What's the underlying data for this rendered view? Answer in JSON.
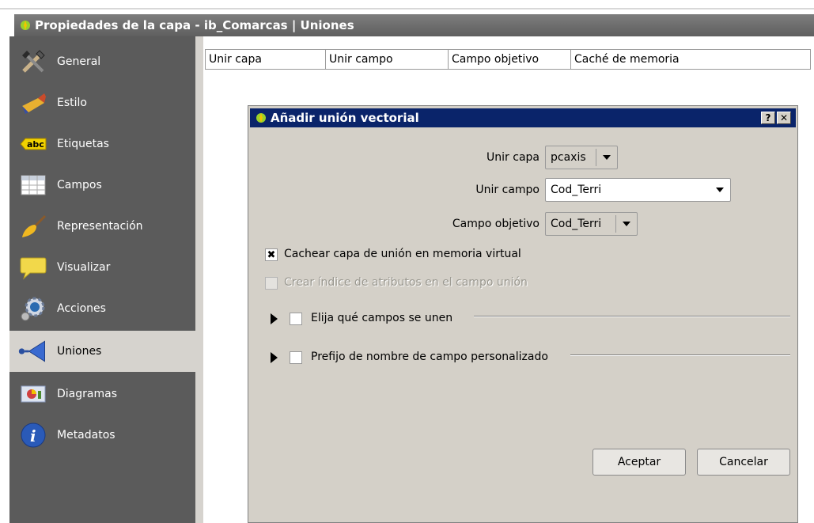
{
  "window": {
    "title": "Propiedades de la capa - ib_Comarcas | Uniones"
  },
  "sidebar": {
    "items": [
      {
        "label": "General",
        "icon": "tools-icon"
      },
      {
        "label": "Estilo",
        "icon": "brush-icon"
      },
      {
        "label": "Etiquetas",
        "icon": "abc-label-icon"
      },
      {
        "label": "Campos",
        "icon": "table-icon"
      },
      {
        "label": "Representación",
        "icon": "paintbrush-icon"
      },
      {
        "label": "Visualizar",
        "icon": "speech-bubble-icon"
      },
      {
        "label": "Acciones",
        "icon": "gear-icon"
      },
      {
        "label": "Uniones",
        "icon": "join-icon",
        "active": true
      },
      {
        "label": "Diagramas",
        "icon": "chart-icon"
      },
      {
        "label": "Metadatos",
        "icon": "info-icon"
      }
    ]
  },
  "joins_table": {
    "headers": [
      "Unir capa",
      "Unir campo",
      "Campo objetivo",
      "Caché de memoria"
    ]
  },
  "dialog": {
    "title": "Añadir unión vectorial",
    "help_button": "?",
    "close_button": "✕",
    "join_layer_label": "Unir capa",
    "join_layer_value": "pcaxis",
    "join_field_label": "Unir campo",
    "join_field_value": "Cod_Terri",
    "target_field_label": "Campo objetivo",
    "target_field_value": "Cod_Terri",
    "cache_checkbox_label": "Cachear capa de unión en memoria virtual",
    "cache_checked": true,
    "index_checkbox_label": "Crear índice de atributos en el campo unión",
    "index_disabled": true,
    "choose_fields_label": "Elija qué campos se unen",
    "prefix_label": "Prefijo de nombre de campo personalizado",
    "ok_label": "Aceptar",
    "cancel_label": "Cancelar"
  },
  "colors": {
    "sidebar_bg": "#5b5b5b",
    "dialog_titlebar": "#0a246a",
    "dialog_bg": "#d4d0c8"
  }
}
